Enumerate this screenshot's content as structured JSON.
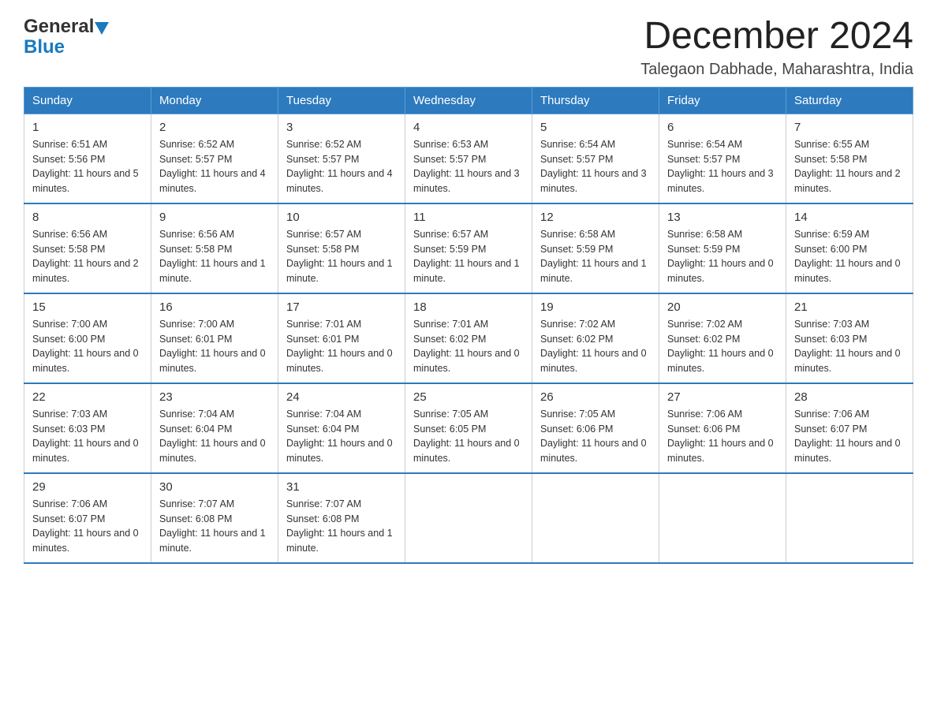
{
  "header": {
    "logo_general": "General",
    "logo_blue": "Blue",
    "main_title": "December 2024",
    "subtitle": "Talegaon Dabhade, Maharashtra, India"
  },
  "days_of_week": [
    "Sunday",
    "Monday",
    "Tuesday",
    "Wednesday",
    "Thursday",
    "Friday",
    "Saturday"
  ],
  "weeks": [
    [
      {
        "day": "1",
        "sunrise": "6:51 AM",
        "sunset": "5:56 PM",
        "daylight": "11 hours and 5 minutes."
      },
      {
        "day": "2",
        "sunrise": "6:52 AM",
        "sunset": "5:57 PM",
        "daylight": "11 hours and 4 minutes."
      },
      {
        "day": "3",
        "sunrise": "6:52 AM",
        "sunset": "5:57 PM",
        "daylight": "11 hours and 4 minutes."
      },
      {
        "day": "4",
        "sunrise": "6:53 AM",
        "sunset": "5:57 PM",
        "daylight": "11 hours and 3 minutes."
      },
      {
        "day": "5",
        "sunrise": "6:54 AM",
        "sunset": "5:57 PM",
        "daylight": "11 hours and 3 minutes."
      },
      {
        "day": "6",
        "sunrise": "6:54 AM",
        "sunset": "5:57 PM",
        "daylight": "11 hours and 3 minutes."
      },
      {
        "day": "7",
        "sunrise": "6:55 AM",
        "sunset": "5:58 PM",
        "daylight": "11 hours and 2 minutes."
      }
    ],
    [
      {
        "day": "8",
        "sunrise": "6:56 AM",
        "sunset": "5:58 PM",
        "daylight": "11 hours and 2 minutes."
      },
      {
        "day": "9",
        "sunrise": "6:56 AM",
        "sunset": "5:58 PM",
        "daylight": "11 hours and 1 minute."
      },
      {
        "day": "10",
        "sunrise": "6:57 AM",
        "sunset": "5:58 PM",
        "daylight": "11 hours and 1 minute."
      },
      {
        "day": "11",
        "sunrise": "6:57 AM",
        "sunset": "5:59 PM",
        "daylight": "11 hours and 1 minute."
      },
      {
        "day": "12",
        "sunrise": "6:58 AM",
        "sunset": "5:59 PM",
        "daylight": "11 hours and 1 minute."
      },
      {
        "day": "13",
        "sunrise": "6:58 AM",
        "sunset": "5:59 PM",
        "daylight": "11 hours and 0 minutes."
      },
      {
        "day": "14",
        "sunrise": "6:59 AM",
        "sunset": "6:00 PM",
        "daylight": "11 hours and 0 minutes."
      }
    ],
    [
      {
        "day": "15",
        "sunrise": "7:00 AM",
        "sunset": "6:00 PM",
        "daylight": "11 hours and 0 minutes."
      },
      {
        "day": "16",
        "sunrise": "7:00 AM",
        "sunset": "6:01 PM",
        "daylight": "11 hours and 0 minutes."
      },
      {
        "day": "17",
        "sunrise": "7:01 AM",
        "sunset": "6:01 PM",
        "daylight": "11 hours and 0 minutes."
      },
      {
        "day": "18",
        "sunrise": "7:01 AM",
        "sunset": "6:02 PM",
        "daylight": "11 hours and 0 minutes."
      },
      {
        "day": "19",
        "sunrise": "7:02 AM",
        "sunset": "6:02 PM",
        "daylight": "11 hours and 0 minutes."
      },
      {
        "day": "20",
        "sunrise": "7:02 AM",
        "sunset": "6:02 PM",
        "daylight": "11 hours and 0 minutes."
      },
      {
        "day": "21",
        "sunrise": "7:03 AM",
        "sunset": "6:03 PM",
        "daylight": "11 hours and 0 minutes."
      }
    ],
    [
      {
        "day": "22",
        "sunrise": "7:03 AM",
        "sunset": "6:03 PM",
        "daylight": "11 hours and 0 minutes."
      },
      {
        "day": "23",
        "sunrise": "7:04 AM",
        "sunset": "6:04 PM",
        "daylight": "11 hours and 0 minutes."
      },
      {
        "day": "24",
        "sunrise": "7:04 AM",
        "sunset": "6:04 PM",
        "daylight": "11 hours and 0 minutes."
      },
      {
        "day": "25",
        "sunrise": "7:05 AM",
        "sunset": "6:05 PM",
        "daylight": "11 hours and 0 minutes."
      },
      {
        "day": "26",
        "sunrise": "7:05 AM",
        "sunset": "6:06 PM",
        "daylight": "11 hours and 0 minutes."
      },
      {
        "day": "27",
        "sunrise": "7:06 AM",
        "sunset": "6:06 PM",
        "daylight": "11 hours and 0 minutes."
      },
      {
        "day": "28",
        "sunrise": "7:06 AM",
        "sunset": "6:07 PM",
        "daylight": "11 hours and 0 minutes."
      }
    ],
    [
      {
        "day": "29",
        "sunrise": "7:06 AM",
        "sunset": "6:07 PM",
        "daylight": "11 hours and 0 minutes."
      },
      {
        "day": "30",
        "sunrise": "7:07 AM",
        "sunset": "6:08 PM",
        "daylight": "11 hours and 1 minute."
      },
      {
        "day": "31",
        "sunrise": "7:07 AM",
        "sunset": "6:08 PM",
        "daylight": "11 hours and 1 minute."
      },
      null,
      null,
      null,
      null
    ]
  ]
}
